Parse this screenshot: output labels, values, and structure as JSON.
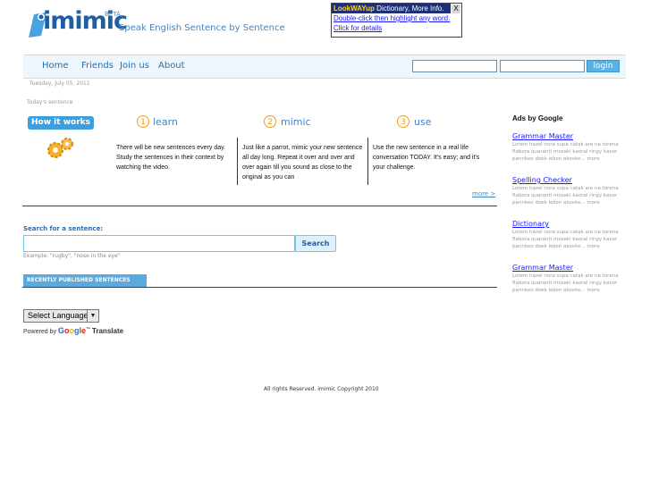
{
  "brand": {
    "logo_text": "imimic",
    "beta": "BETA",
    "tagline": "Speak English Sentence by Sentence"
  },
  "lookwayup": {
    "brand": "LookWAYup",
    "header_rest": " Dictionary, More Info.",
    "close": "X",
    "line1": "Double-click then highlight any word.",
    "line2": "Click for details"
  },
  "nav": {
    "items": [
      "Home",
      "Friends",
      "Join us",
      "About"
    ],
    "login_label": "login"
  },
  "date": "Tuesday, July 05, 2011",
  "today_label": "Today's sentence",
  "how_it_works": "How it works",
  "steps": [
    {
      "num": "1",
      "label": "learn",
      "text": "There will be new sentences every day. Study the sentences in their context by watching the video."
    },
    {
      "num": "2",
      "label": "mimic",
      "text": "Just like a parrot, mimic your new sentence all day long. Repeat it over and over and over again till you sound as close to the original as you can"
    },
    {
      "num": "3",
      "label": "use",
      "text": "Use the new sentence in a real life conversation TODAY. It's easy; and it's your challenge."
    }
  ],
  "more_link": "more >",
  "search": {
    "label": "Search for a sentence:",
    "button": "Search",
    "example": "Example: \"rugby\", \"nose in the eye\""
  },
  "recent_label": "RECENTLY PUBLISHED SENTENCES",
  "translate": {
    "select_label": "Select Language",
    "arrow": "▼",
    "powered_by": "Powered by",
    "google": "Google",
    "tm": "™",
    "translate": "Translate"
  },
  "footer": "All rights Reserved. imimic Copyright 2010",
  "ads": {
    "heading": "Ads by Google",
    "items": [
      {
        "title": "Grammar Master",
        "desc": "Lorem hazel nora supa catak are na torena flabora quaranti mosaki kaoral ringy kavor pannkeo doek iekon akovke... more"
      },
      {
        "title": "Spelling Checker",
        "desc": "Lorem hazel nora supa catak are na torena flabora quaranti mosaki kaoral ringy kavor pannkeo doek iekon akovke... more"
      },
      {
        "title": "Dictionary",
        "desc": "Lorem hazel nora supa catak are na torena flabora quaranti mosaki kaoral ringy kavor pannkeo doek iekon akovke... more"
      },
      {
        "title": "Grammar Master",
        "desc": "Lorem hazel nora supa catak are na torena flabora quaranti mosaki kaoral ringy kavor pannkeo doek iekon akovke... more"
      }
    ]
  }
}
